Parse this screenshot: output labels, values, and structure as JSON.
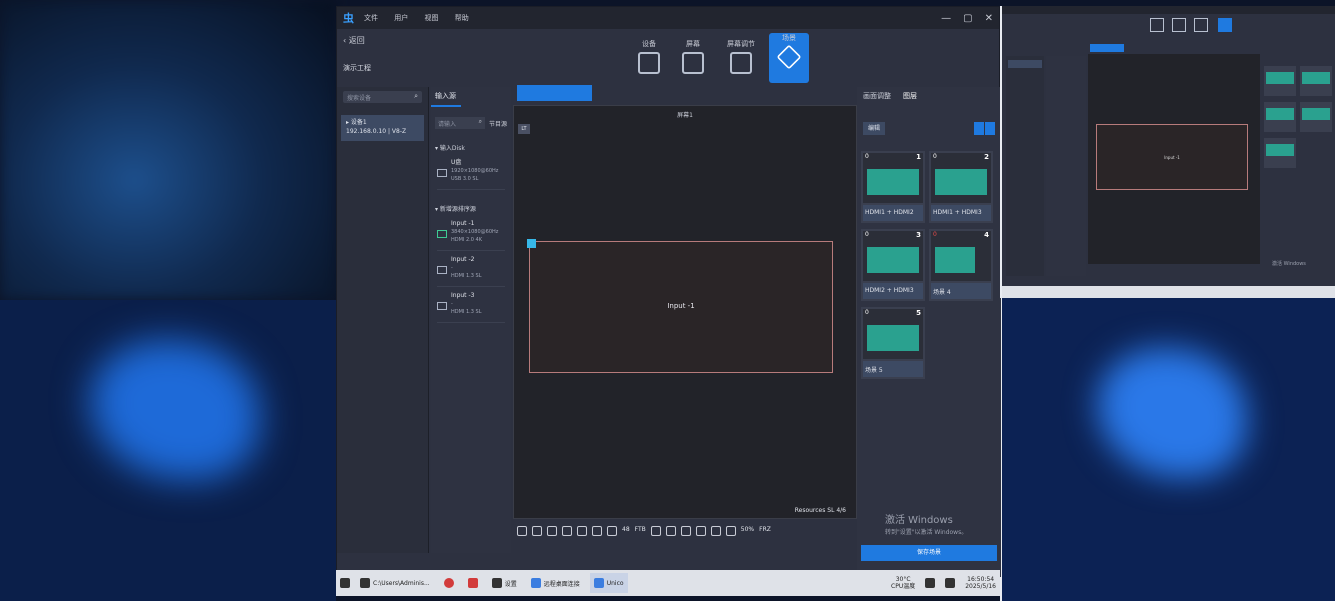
{
  "app": {
    "logo": "虫",
    "menu": [
      "文件",
      "用户",
      "视图",
      "帮助"
    ],
    "win_controls": [
      "—",
      "▢",
      "✕"
    ]
  },
  "nav": {
    "back": "‹ 返回",
    "project_title": "演示工程"
  },
  "toolbar": [
    {
      "label": "设备",
      "icon": "device-icon",
      "active": false
    },
    {
      "label": "屏幕",
      "icon": "screen-icon",
      "active": false
    },
    {
      "label": "屏幕调节",
      "icon": "screen-adjust-icon",
      "active": false
    },
    {
      "label": "场景",
      "icon": "layers-icon",
      "active": true
    }
  ],
  "device_panel": {
    "search_placeholder": "搜索设备",
    "item_name": "▸ 设备1",
    "item_ip": "192.168.0.10 | V8-Z"
  },
  "input_panel": {
    "tab": "输入源",
    "search_placeholder": "请输入",
    "search_extra": "节目源",
    "group1": "▾ 输入Disk",
    "disk": {
      "name": "U盘",
      "res": "1920×1080@60Hz",
      "port": "USB 3.0 SL"
    },
    "group2": "▾ 新增源排序源",
    "sources": [
      {
        "name": "Input -1",
        "res": "3840×1080@60Hz",
        "port": "HDMI 2.0 4K",
        "on": true
      },
      {
        "name": "Input -2",
        "res": "-",
        "port": "HDMI 1.3 SL",
        "on": false
      },
      {
        "name": "Input -3",
        "res": "-",
        "port": "HDMI 1.3 SL",
        "on": false
      }
    ]
  },
  "canvas": {
    "title": "屏幕1",
    "corner": "LT",
    "window_label": "Input -1",
    "resources": "Resources SL  4/6"
  },
  "canvas_tools": {
    "fps_label": "48",
    "pct_label": "50%",
    "ftb": "FTB",
    "frz": "FRZ"
  },
  "layout_panel": {
    "tabs": [
      "画面调整",
      "图层"
    ],
    "edit_btn": "编辑",
    "cards": [
      {
        "num": "1",
        "zero": "0",
        "caption": "HDMI1 + HDMI2",
        "red": false
      },
      {
        "num": "2",
        "zero": "0",
        "caption": "HDMI1 + HDMI3",
        "red": false
      },
      {
        "num": "3",
        "zero": "0",
        "caption": "HDMI2 + HDMI3",
        "red": false
      },
      {
        "num": "4",
        "zero": "0",
        "caption": "场景 4",
        "red": true
      },
      {
        "num": "5",
        "zero": "0",
        "caption": "场景 5",
        "red": false
      }
    ],
    "activate_title": "激活 Windows",
    "activate_sub": "转到\"设置\"以激活 Windows。",
    "save_btn": "保存场景"
  },
  "taskbar": {
    "items": [
      {
        "label": "C:\\Users\\Adminis...",
        "icon": "terminal-icon"
      },
      {
        "label": "",
        "icon": "chrome-icon"
      },
      {
        "label": "",
        "icon": "app-red-icon"
      },
      {
        "label": "设置",
        "icon": "settings-icon"
      },
      {
        "label": "远程桌面连接",
        "icon": "remote-icon"
      },
      {
        "label": "Unico",
        "icon": "unico-icon",
        "active": true
      }
    ],
    "weather_temp": "30°C",
    "weather_label": "CPU温度",
    "time": "16:50:54",
    "date": "2025/5/16"
  },
  "mini": {
    "window_label": "Input -1",
    "activate": "激活 Windows"
  }
}
